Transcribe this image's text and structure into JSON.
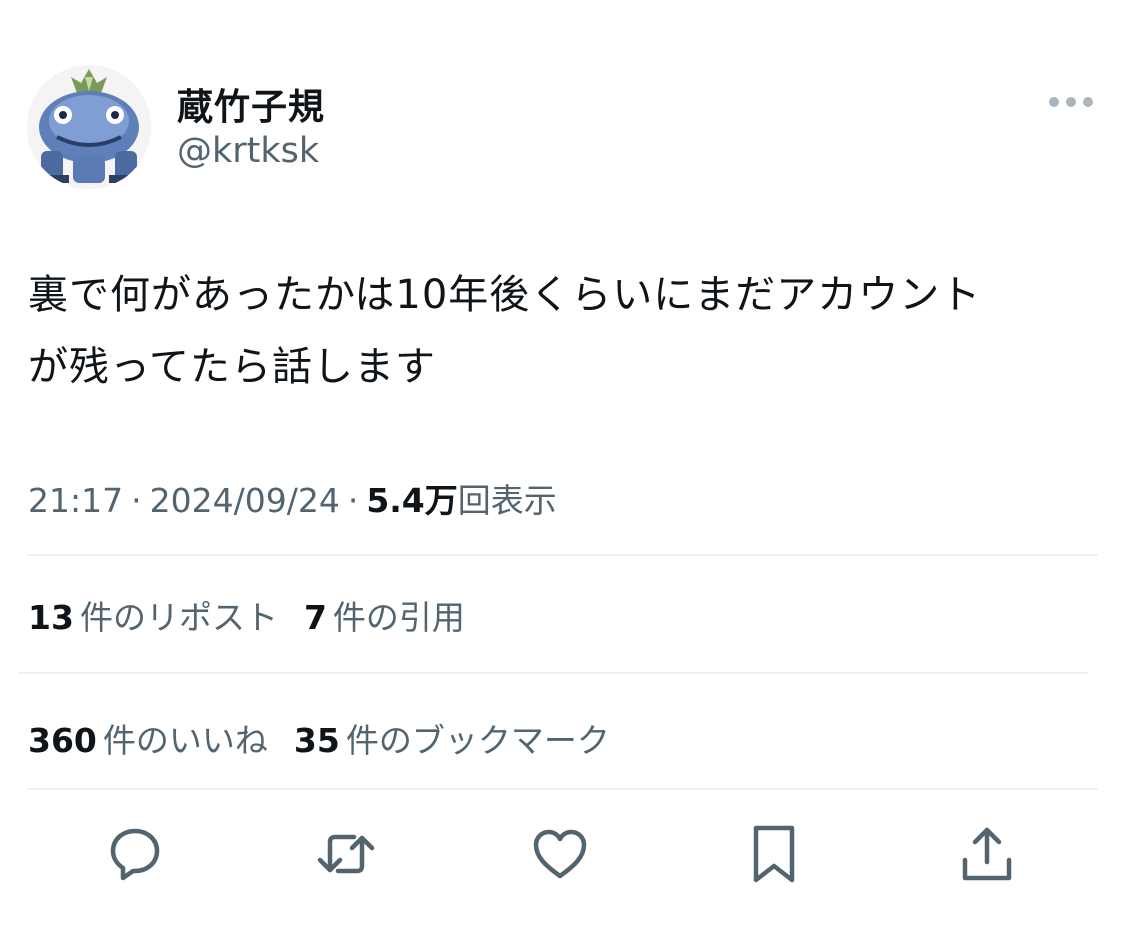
{
  "author": {
    "display_name": "蔵竹子規",
    "handle": "@krtksk",
    "avatar_icon": "pixel-monster-avatar"
  },
  "more_icon": "more-horizontal-icon",
  "tweet": {
    "text_line1": "裏で何があったかは10年後くらいにまだアカウント",
    "text_line2": "が残ってたら話します"
  },
  "meta": {
    "time": "21:17",
    "separator": "·",
    "date": "2024/09/24",
    "views_count": "5.4万",
    "views_label": "回表示"
  },
  "stats": {
    "reposts": {
      "num": "13",
      "label": "件のリポスト"
    },
    "quotes": {
      "num": "7",
      "label": "件の引用"
    },
    "likes": {
      "num": "360",
      "label": "件のいいね"
    },
    "bookmarks": {
      "num": "35",
      "label": "件のブックマーク"
    }
  },
  "actions": [
    "reply-icon",
    "repost-icon",
    "like-icon",
    "bookmark-icon",
    "share-icon"
  ],
  "colors": {
    "text": "#0f1419",
    "secondary": "#536471",
    "divider": "#eff3f4"
  }
}
